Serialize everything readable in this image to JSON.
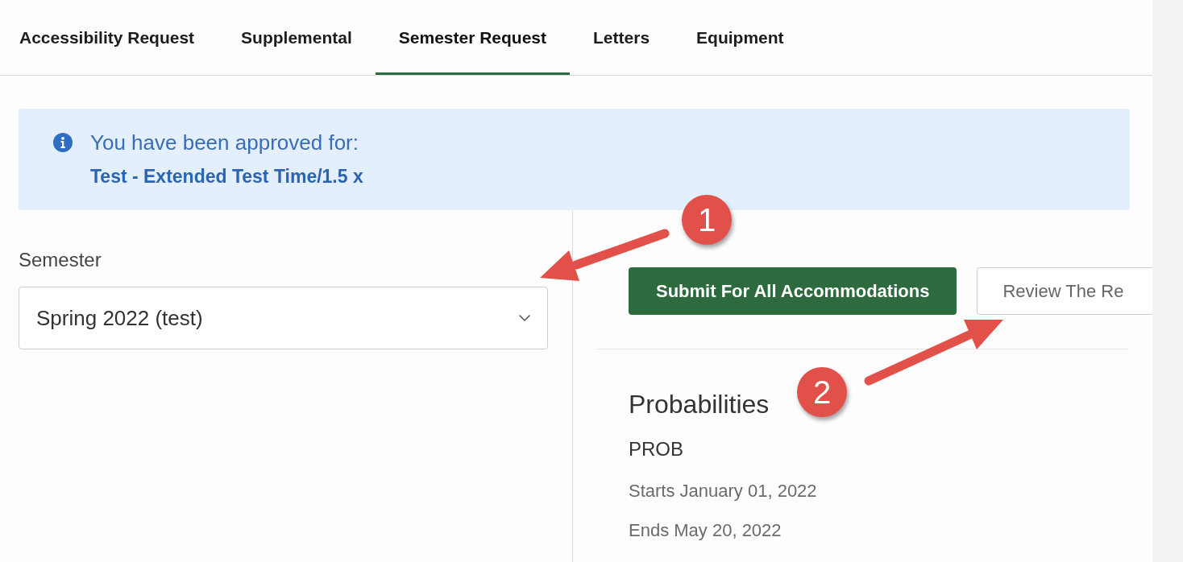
{
  "tabs": [
    {
      "label": "Accessibility Request",
      "selected": false
    },
    {
      "label": "Supplemental",
      "selected": false
    },
    {
      "label": "Semester Request",
      "selected": true
    },
    {
      "label": "Letters",
      "selected": false
    },
    {
      "label": "Equipment",
      "selected": false
    }
  ],
  "alert": {
    "message": "You have been approved for:",
    "detail": "Test - Extended Test Time/1.5 x"
  },
  "semester_field": {
    "label": "Semester",
    "value": "Spring 2022 (test)"
  },
  "buttons": [
    {
      "label": "Submit For All Accommodations",
      "kind": "primary"
    },
    {
      "label": "Review The Re",
      "kind": "secondary"
    }
  ],
  "course": {
    "title": "Probabilities",
    "code": "PROB",
    "starts": "Starts January 01, 2022",
    "ends": "Ends May 20, 2022"
  },
  "annotations": [
    {
      "label": "1"
    },
    {
      "label": "2"
    }
  ]
}
